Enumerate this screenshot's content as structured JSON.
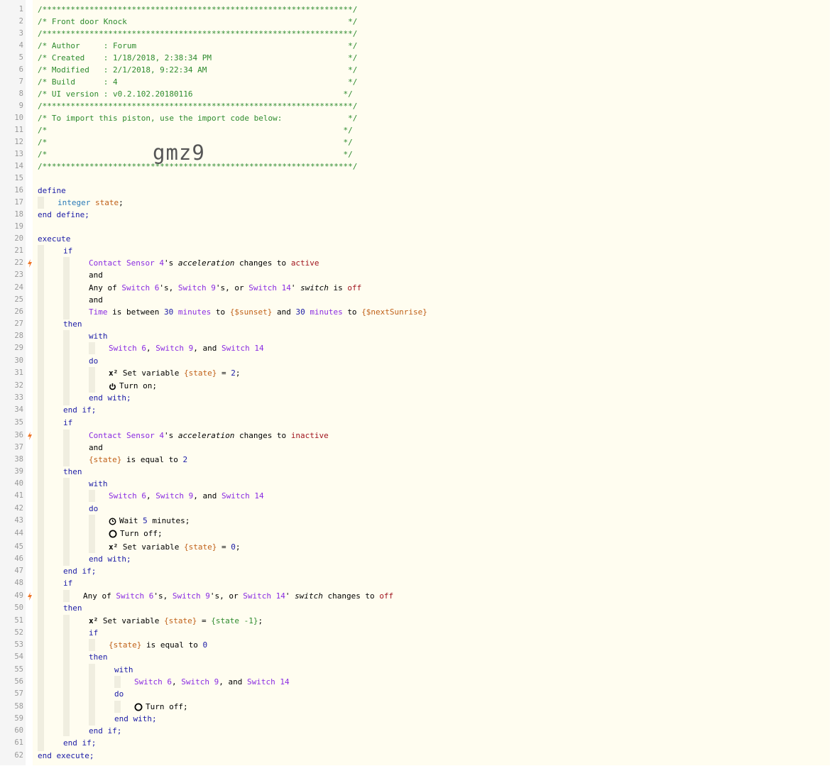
{
  "code": {
    "line_numbers": [
      "1",
      "2",
      "3",
      "4",
      "5",
      "6",
      "7",
      "8",
      "9",
      "10",
      "11",
      "12",
      "13",
      "14",
      "15",
      "16",
      "17",
      "18",
      "19",
      "20",
      "21",
      "22",
      "23",
      "24",
      "25",
      "26",
      "27",
      "28",
      "29",
      "30",
      "31",
      "32",
      "33",
      "34",
      "35",
      "36",
      "37",
      "38",
      "39",
      "40",
      "41",
      "42",
      "43",
      "44",
      "45",
      "46",
      "47",
      "48",
      "49",
      "50",
      "51",
      "52",
      "53",
      "54",
      "55",
      "56",
      "57",
      "58",
      "59",
      "60",
      "61",
      "62"
    ],
    "header": {
      "stars": "/******************************************************************/",
      "title": "/* Front door Knock                                               */",
      "author": "/* Author     : Forum                                             */",
      "created": "/* Created    : 1/18/2018, 2:38:34 PM                             */",
      "modified": "/* Modified   : 2/1/2018, 9:22:34 AM                              */",
      "build": "/* Build      : 4                                                 */",
      "ui_version": "/* UI version : v0.2.102.20180116                                */",
      "import_note": "/* To import this piston, use the import code below:              */",
      "blank": "/*                                                               */"
    },
    "watermark": "gmz9",
    "kw": {
      "define": "define",
      "integer": "integer",
      "end_define": "end define;",
      "execute": "execute",
      "if": "if",
      "and": "and",
      "then": "then",
      "with": "with",
      "do": "do",
      "end_with": "end with;",
      "end_if": "end if;",
      "end_execute": "end execute;"
    },
    "state_var": "state",
    "devices": {
      "contact": "Contact Sensor 4",
      "sw6": "Switch 6",
      "sw9": "Switch 9",
      "sw14": "Switch 14"
    },
    "text": {
      "s_possessive": "'s",
      "attr_accel": "acceleration",
      "changes_to": "changes to",
      "active": "active",
      "inactive": "inactive",
      "any_of": "Any of",
      "comma": ",",
      "or": "or",
      "and_word": "and",
      "apostrophe": "'",
      "switch_attr": "switch",
      "is": "is",
      "off": "off",
      "time": "Time",
      "is_between": "is between",
      "n30": "30",
      "minutes": "minutes",
      "to": "to",
      "sunset": "{$sunset}",
      "next_sunrise": "{$nextSunrise}",
      "set_variable": "Set variable",
      "state_ref": "{state}",
      "eq": "=",
      "val2": "2",
      "val0": "0",
      "semi": ";",
      "turn_on": "Turn on;",
      "turn_off": "Turn off;",
      "wait": "Wait",
      "five": "5",
      "minutes_semi": "minutes;",
      "is_equal_to": "is equal to",
      "state_minus": "{state -1}",
      "x2": "x²"
    }
  }
}
